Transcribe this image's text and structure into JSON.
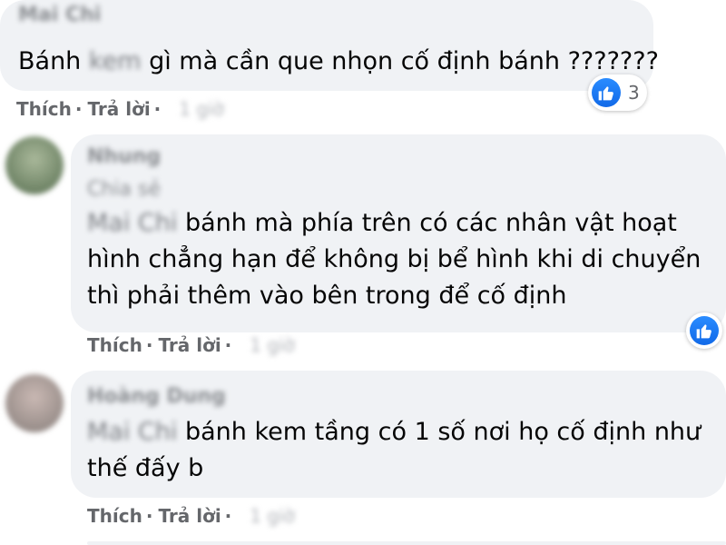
{
  "comments": [
    {
      "author": "Mai Chi",
      "mention": "kem",
      "lines": [
        "Bánh ",
        "gì mà cần que nhọn cố định bánh ???????"
      ],
      "actions": {
        "like": "Thích",
        "reply": "Trả lời",
        "time": "1 giờ"
      },
      "reaction_count": "3"
    },
    {
      "author": "Nhung",
      "subline": "Chia sẻ",
      "mention": "Mai Chi",
      "lines": [
        "bánh mà phía trên có các nhân vật hoạt",
        "hình chẳng hạn để không bị bể hình khi di chuyển",
        "thì phải thêm vào bên trong để cố định"
      ],
      "actions": {
        "like": "Thích",
        "reply": "Trả lời",
        "time": "1 giờ"
      }
    },
    {
      "author": "Hoàng Dung",
      "mention": "Mai Chi",
      "lines": [
        "bánh kem tầng có 1 số nơi họ cố định như",
        "thế đấy b"
      ],
      "actions": {
        "like": "Thích",
        "reply": "Trả lời",
        "time": "1 giờ"
      }
    }
  ],
  "colors": {
    "bubble": "#f0f2f5",
    "action_text": "#65676b",
    "like_blue": "#1877f2"
  },
  "icons": [
    "like-icon"
  ]
}
